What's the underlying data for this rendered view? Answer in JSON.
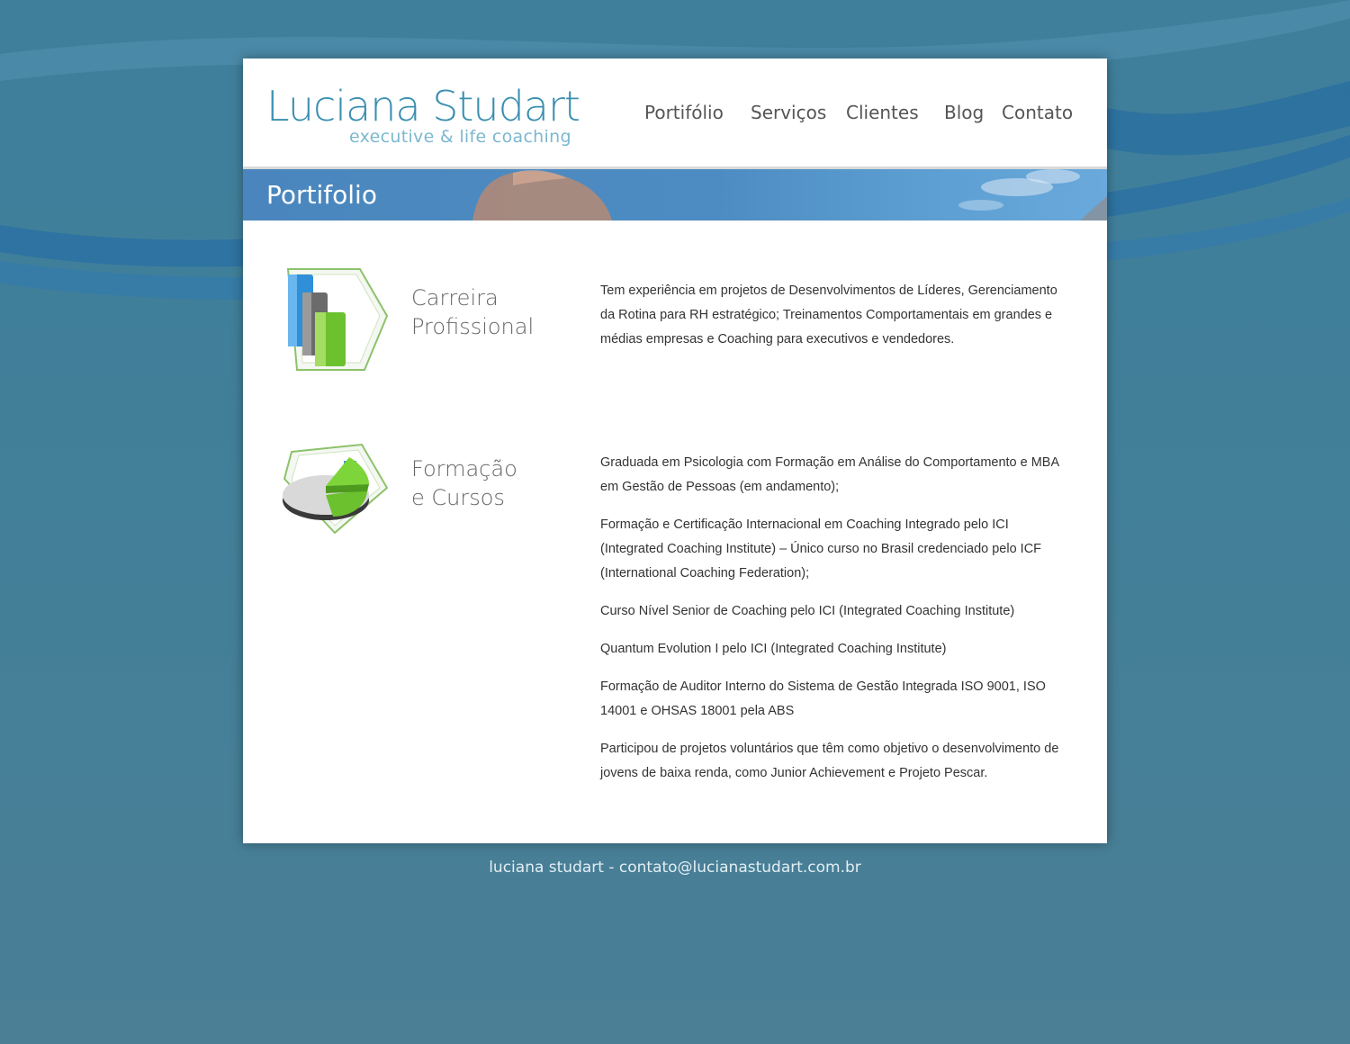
{
  "header": {
    "logo_name": "Luciana Studart",
    "logo_tagline": "executive & life coaching"
  },
  "nav": {
    "items": [
      "Portifólio",
      "Serviços",
      "Clientes",
      "Blog",
      "Contato"
    ]
  },
  "banner": {
    "title": "Portifolio"
  },
  "sections": [
    {
      "icon": "bar-chart-icon",
      "title_lines": [
        "Carreira",
        "Profissional"
      ],
      "paragraphs": [
        "Tem experiência em projetos de Desenvolvimentos de Líderes, Gerenciamento da Rotina para RH estratégico; Treinamentos Comportamentais em grandes e médias empresas e Coaching para executivos e vendedores."
      ]
    },
    {
      "icon": "pie-chart-icon",
      "title_lines": [
        "Formação",
        "e Cursos"
      ],
      "paragraphs": [
        "Graduada em Psicologia com Formação em Análise do Comportamento e MBA em Gestão de Pessoas (em andamento);",
        "Formação e Certificação Internacional em Coaching Integrado pelo ICI (Integrated Coaching Institute) – Único curso no Brasil credenciado pelo ICF (International Coaching Federation);",
        "Curso Nível Senior de Coaching pelo ICI (Integrated Coaching Institute)",
        "Quantum Evolution I pelo ICI (Integrated Coaching Institute)",
        "Formação de Auditor Interno do Sistema de Gestão Integrada ISO 9001, ISO 14001 e OHSAS 18001 pela ABS",
        "Participou de projetos voluntários que têm como objetivo o desenvolvimento de jovens de baixa renda, como Junior Achievement e Projeto Pescar."
      ]
    }
  ],
  "footer": {
    "text": "luciana studart - contato@lucianastudart.com.br"
  },
  "colors": {
    "brand": "#3a8fb0",
    "background": "#417f99",
    "banner": "#4d8cc2",
    "accent_green": "#7ac143"
  }
}
